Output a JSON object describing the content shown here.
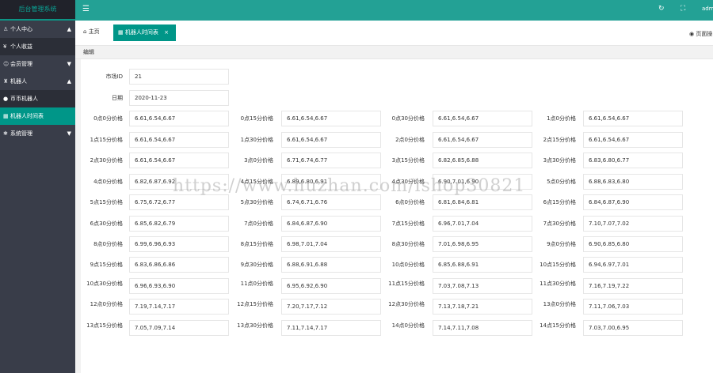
{
  "sidebar": {
    "logo": "后台管理系统",
    "groups": [
      {
        "label": "个人中心",
        "icon": "user-icon",
        "arrow": "▲",
        "children": [
          {
            "label": "个人收益",
            "icon": "yen-icon",
            "active": false
          }
        ]
      },
      {
        "label": "会员管理",
        "icon": "smile-icon",
        "arrow": "▼",
        "children": []
      },
      {
        "label": "机器人",
        "icon": "robot-icon",
        "arrow": "▲",
        "children": [
          {
            "label": "币币机器人",
            "icon": "circle-icon",
            "active": false
          },
          {
            "label": "机器人时间表",
            "icon": "table-icon",
            "active": true
          }
        ]
      },
      {
        "label": "系统管理",
        "icon": "gear-icon",
        "arrow": "▼",
        "children": []
      }
    ]
  },
  "topbar": {
    "menu_icon": "☰",
    "refresh_icon": "↻",
    "fullscreen_icon": "⛶",
    "user": "admin"
  },
  "tabs": {
    "home_label": "主页",
    "active_label": "机器人时间表",
    "close": "×",
    "page_op": "页面操"
  },
  "section": {
    "title": "编辑"
  },
  "form": {
    "market_id_label": "市场ID",
    "market_id_value": "21",
    "date_label": "日期",
    "date_value": "2020-11-23",
    "rows": [
      [
        [
          "0点0分价格",
          "6.61,6.54,6.67"
        ],
        [
          "0点15分价格",
          "6.61,6.54,6.67"
        ],
        [
          "0点30分价格",
          "6.61,6.54,6.67"
        ],
        [
          "1点0分价格",
          "6.61,6.54,6.67"
        ]
      ],
      [
        [
          "1点15分价格",
          "6.61,6.54,6.67"
        ],
        [
          "1点30分价格",
          "6.61,6.54,6.67"
        ],
        [
          "2点0分价格",
          "6.61,6.54,6.67"
        ],
        [
          "2点15分价格",
          "6.61,6.54,6.67"
        ]
      ],
      [
        [
          "2点30分价格",
          "6.61,6.54,6.67"
        ],
        [
          "3点0分价格",
          "6.71,6.74,6.77"
        ],
        [
          "3点15分价格",
          "6.82,6.85,6.88"
        ],
        [
          "3点30分价格",
          "6.83,6.80,6.77"
        ]
      ],
      [
        [
          "4点0分价格",
          "6.82,6.87,6.92"
        ],
        [
          "4点15分价格",
          "6.89,6.80,6.91"
        ],
        [
          "4点30分价格",
          "6.90,7.01,6.90"
        ],
        [
          "5点0分价格",
          "6.88,6.83,6.80"
        ]
      ],
      [
        [
          "5点15分价格",
          "6.75,6.72,6.77"
        ],
        [
          "5点30分价格",
          "6.74,6.71,6.76"
        ],
        [
          "6点0分价格",
          "6.81,6.84,6.81"
        ],
        [
          "6点15分价格",
          "6.84,6.87,6.90"
        ]
      ],
      [
        [
          "6点30分价格",
          "6.85,6.82,6.79"
        ],
        [
          "7点0分价格",
          "6.84,6.87,6.90"
        ],
        [
          "7点15分价格",
          "6.96,7.01,7.04"
        ],
        [
          "7点30分价格",
          "7.10,7.07,7.02"
        ]
      ],
      [
        [
          "8点0分价格",
          "6.99,6.96,6.93"
        ],
        [
          "8点15分价格",
          "6.98,7.01,7.04"
        ],
        [
          "8点30分价格",
          "7.01,6.98,6.95"
        ],
        [
          "9点0分价格",
          "6.90,6.85,6.80"
        ]
      ],
      [
        [
          "9点15分价格",
          "6.83,6.86,6.86"
        ],
        [
          "9点30分价格",
          "6.88,6.91,6.88"
        ],
        [
          "10点0分价格",
          "6.85,6.88,6.91"
        ],
        [
          "10点15分价格",
          "6.94,6.97,7.01"
        ]
      ],
      [
        [
          "10点30分价格",
          "6.96,6.93,6.90"
        ],
        [
          "11点0分价格",
          "6.95,6.92,6.90"
        ],
        [
          "11点15分价格",
          "7.03,7.08,7.13"
        ],
        [
          "11点30分价格",
          "7.16,7.19,7.22"
        ]
      ],
      [
        [
          "12点0分价格",
          "7.19,7.14,7.17"
        ],
        [
          "12点15分价格",
          "7.20,7.17,7.12"
        ],
        [
          "12点30分价格",
          "7.13,7.18,7.21"
        ],
        [
          "13点0分价格",
          "7.11,7.06,7.03"
        ]
      ],
      [
        [
          "13点15分价格",
          "7.05,7.09,7.14"
        ],
        [
          "13点30分价格",
          "7.11,7.14,7.17"
        ],
        [
          "14点0分价格",
          "7.14,7.11,7.08"
        ],
        [
          "14点15分价格",
          "7.03,7.00,6.95"
        ]
      ]
    ]
  },
  "watermark": "https://www.huzhan.com/ishop30821"
}
